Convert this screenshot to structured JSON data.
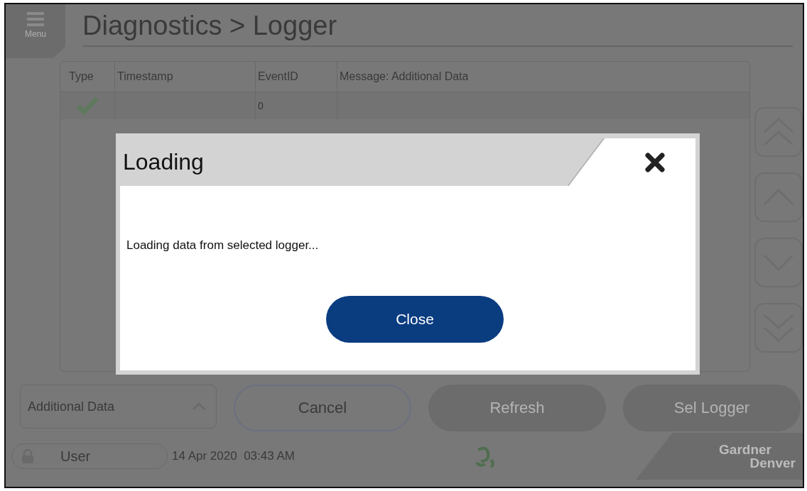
{
  "menu": {
    "label": "Menu"
  },
  "header": {
    "title": "Diagnostics > Logger"
  },
  "table": {
    "columns": [
      "Type",
      "Timestamp",
      "EventID",
      "Message: Additional Data"
    ],
    "rows": [
      {
        "kind": "success",
        "event_id": "0"
      }
    ]
  },
  "scroll_buttons": [
    {
      "kind": "page-up"
    },
    {
      "kind": "up"
    },
    {
      "kind": "down"
    },
    {
      "kind": "page-down"
    }
  ],
  "controls": {
    "dropdown": {
      "value": "Additional Data",
      "expanded": false
    },
    "buttons": [
      {
        "label": "Cancel",
        "kind": "outline"
      },
      {
        "label": "Refresh",
        "kind": "filled"
      },
      {
        "label": "Sel Logger",
        "kind": "filled"
      }
    ]
  },
  "status_bar": {
    "user": "User",
    "locked": true,
    "datetime": "14 Apr 2020  03:43 AM",
    "brand": [
      "Gardner",
      "Denver"
    ]
  },
  "dialog": {
    "title": "Loading",
    "message": "Loading data from selected logger...",
    "button": "Close"
  }
}
